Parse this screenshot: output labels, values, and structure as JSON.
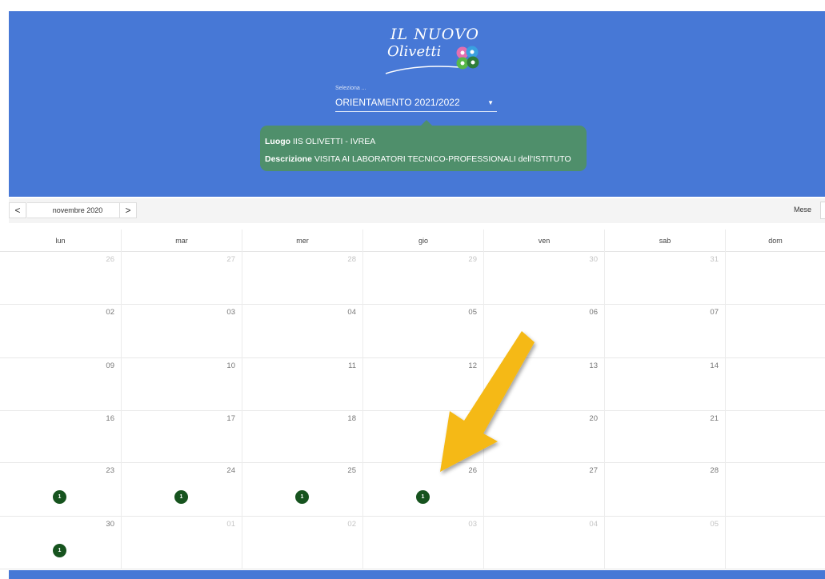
{
  "header": {
    "logo_line1": "IL NUOVO",
    "logo_line2": "Olivetti",
    "dot_colors": [
      "#e36fb0",
      "#3aa0e0",
      "#57b848",
      "#2f7d3a"
    ],
    "select_label": "Seleziona ...",
    "select_value": "ORIENTAMENTO 2021/2022"
  },
  "tooltip": {
    "luogo_label": "Luogo",
    "luogo_value": "IIS OLIVETTI - IVREA",
    "descrizione_label": "Descrizione",
    "descrizione_value": "VISITA AI LABORATORI TECNICO-PROFESSIONALI dell'ISTITUTO"
  },
  "toolbar": {
    "prev": "<",
    "month": "novembre 2020",
    "next": ">",
    "view": "Mese"
  },
  "calendar": {
    "days_of_week": [
      "lun",
      "mar",
      "mer",
      "gio",
      "ven",
      "sab",
      "dom"
    ],
    "weeks": [
      [
        {
          "d": "26",
          "other": true
        },
        {
          "d": "27",
          "other": true
        },
        {
          "d": "28",
          "other": true
        },
        {
          "d": "29",
          "other": true
        },
        {
          "d": "30",
          "other": true
        },
        {
          "d": "31",
          "other": true
        },
        {
          "d": "",
          "other": false
        }
      ],
      [
        {
          "d": "02",
          "other": false
        },
        {
          "d": "03",
          "other": false
        },
        {
          "d": "04",
          "other": false
        },
        {
          "d": "05",
          "other": false
        },
        {
          "d": "06",
          "other": false
        },
        {
          "d": "07",
          "other": false
        },
        {
          "d": "",
          "other": false
        }
      ],
      [
        {
          "d": "09",
          "other": false
        },
        {
          "d": "10",
          "other": false
        },
        {
          "d": "11",
          "other": false
        },
        {
          "d": "12",
          "other": false
        },
        {
          "d": "13",
          "other": false
        },
        {
          "d": "14",
          "other": false
        },
        {
          "d": "",
          "other": false
        }
      ],
      [
        {
          "d": "16",
          "other": false
        },
        {
          "d": "17",
          "other": false
        },
        {
          "d": "18",
          "other": false
        },
        {
          "d": "",
          "other": false
        },
        {
          "d": "20",
          "other": false
        },
        {
          "d": "21",
          "other": false
        },
        {
          "d": "",
          "other": false
        }
      ],
      [
        {
          "d": "23",
          "other": false,
          "badge": "1"
        },
        {
          "d": "24",
          "other": false,
          "badge": "1"
        },
        {
          "d": "25",
          "other": false,
          "badge": "1"
        },
        {
          "d": "26",
          "other": false,
          "badge": "1"
        },
        {
          "d": "27",
          "other": false
        },
        {
          "d": "28",
          "other": false
        },
        {
          "d": "",
          "other": false
        }
      ],
      [
        {
          "d": "30",
          "other": false,
          "badge": "1"
        },
        {
          "d": "01",
          "other": true
        },
        {
          "d": "02",
          "other": true
        },
        {
          "d": "03",
          "other": true
        },
        {
          "d": "04",
          "other": true
        },
        {
          "d": "05",
          "other": true
        },
        {
          "d": "",
          "other": false
        }
      ]
    ]
  },
  "colors": {
    "header_bg": "#4778d6",
    "tooltip_bg": "#4f8f6b",
    "badge_bg": "#16531e",
    "arrow": "#f5b912"
  }
}
